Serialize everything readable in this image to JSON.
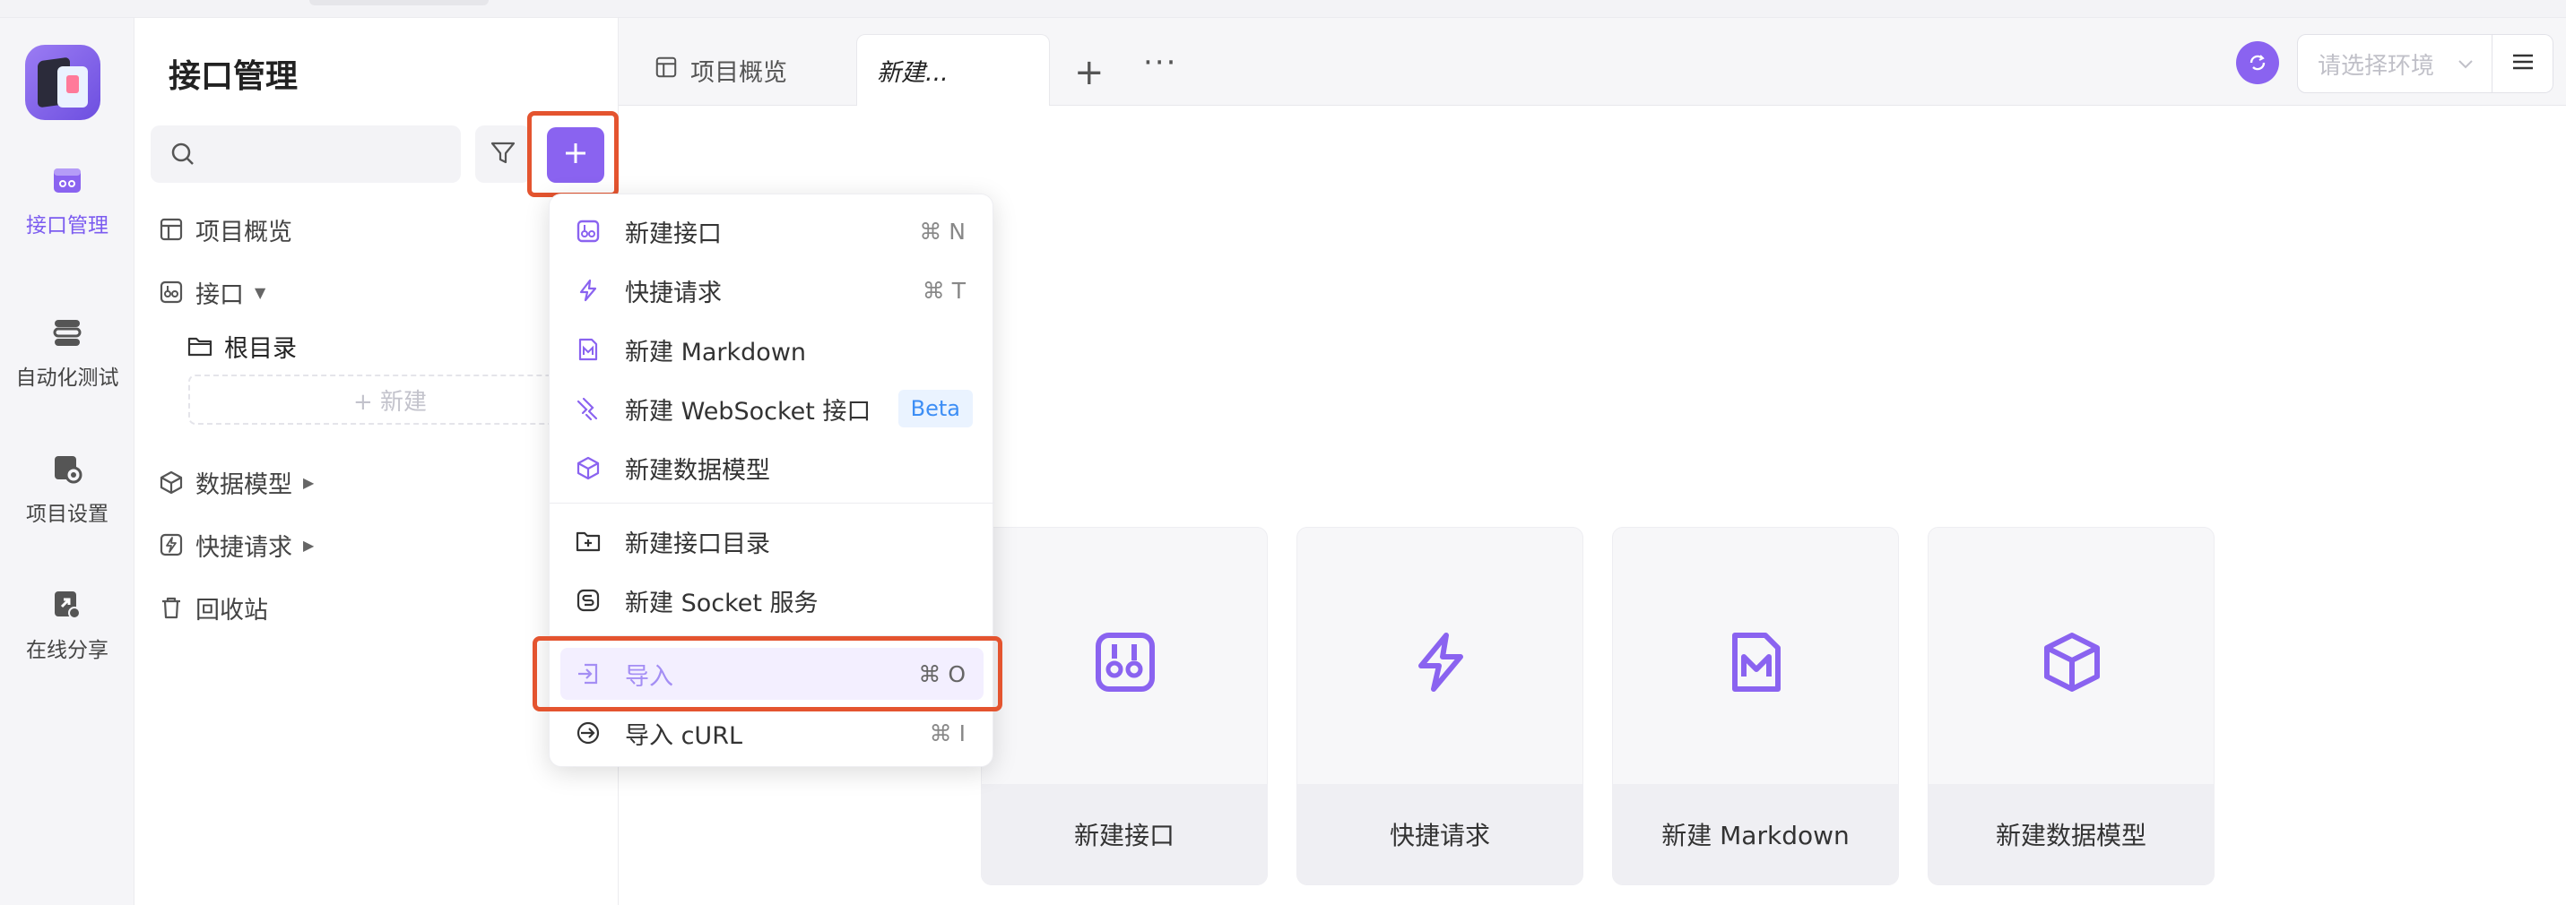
{
  "rail": {
    "items": [
      {
        "label": "接口管理",
        "icon": "api-icon",
        "active": true
      },
      {
        "label": "自动化测试",
        "icon": "automation-icon"
      },
      {
        "label": "项目设置",
        "icon": "project-settings-icon"
      },
      {
        "label": "在线分享",
        "icon": "share-icon"
      }
    ]
  },
  "sidebar": {
    "title": "接口管理",
    "search": {
      "placeholder": ""
    },
    "tree": [
      {
        "label": "项目概览",
        "icon": "overview-icon"
      },
      {
        "label": "接口",
        "icon": "api-icon"
      },
      {
        "label": "根目录",
        "icon": "folder-icon"
      },
      {
        "label": "数据模型",
        "icon": "cube-icon"
      },
      {
        "label": "快捷请求",
        "icon": "lightning-icon"
      },
      {
        "label": "回收站",
        "icon": "trash-icon"
      }
    ],
    "new_label": "+ 新建"
  },
  "tabs": {
    "overview": "项目概览",
    "active": "新建..."
  },
  "env": {
    "placeholder": "请选择环境"
  },
  "dropdown": {
    "items": [
      {
        "label": "新建接口",
        "shortcut": "⌘ N",
        "icon": "api-icon"
      },
      {
        "label": "快捷请求",
        "shortcut": "⌘ T",
        "icon": "lightning-icon"
      },
      {
        "label": "新建 Markdown",
        "shortcut": "",
        "icon": "markdown-icon"
      },
      {
        "label": "新建 WebSocket 接口",
        "badge": "Beta",
        "icon": "websocket-icon"
      },
      {
        "label": "新建数据模型",
        "shortcut": "",
        "icon": "cube-icon"
      },
      {
        "label": "新建接口目录",
        "shortcut": "",
        "icon": "folder-add-icon"
      },
      {
        "label": "新建 Socket 服务",
        "shortcut": "",
        "icon": "socket-icon"
      },
      {
        "label": "导入",
        "shortcut": "⌘ O",
        "icon": "import-icon"
      },
      {
        "label": "导入 cURL",
        "shortcut": "⌘ I",
        "icon": "curl-icon"
      }
    ]
  },
  "cards": [
    {
      "label": "新建接口",
      "icon": "api-icon"
    },
    {
      "label": "快捷请求",
      "icon": "lightning-icon"
    },
    {
      "label": "新建 Markdown",
      "icon": "markdown-icon"
    },
    {
      "label": "新建数据模型",
      "icon": "cube-icon"
    }
  ],
  "colors": {
    "accent": "#8a63f0",
    "highlight": "#e4542f",
    "beta": "#3d8ef5"
  }
}
